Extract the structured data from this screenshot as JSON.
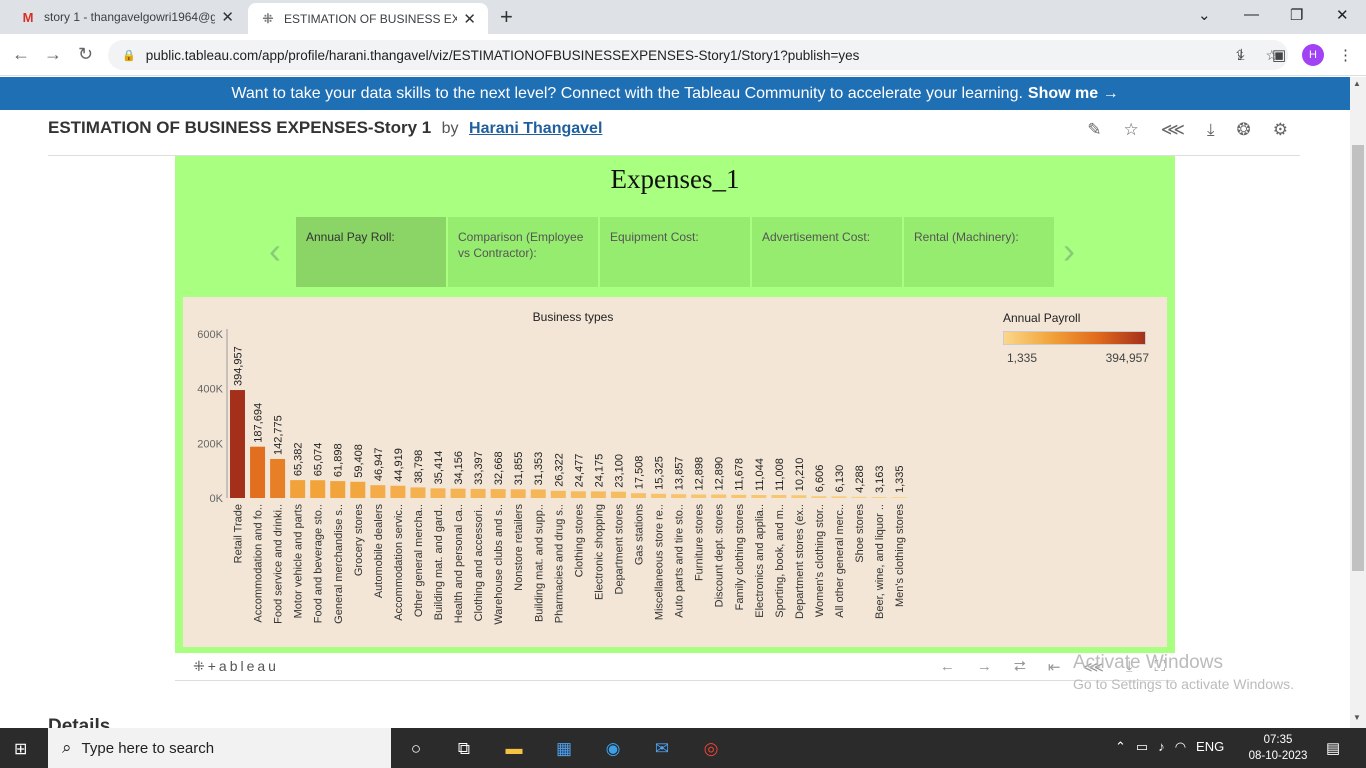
{
  "browser": {
    "tabs": [
      {
        "title": "story 1 - thangavelgowri1964@g",
        "icon": "gmail-icon"
      },
      {
        "title": "ESTIMATION OF BUSINESS EXPE",
        "icon": "tableau-icon"
      }
    ],
    "url": "public.tableau.com/app/profile/harani.thangavel/viz/ESTIMATIONOFBUSINESSEXPENSES-Story1/Story1?publish=yes",
    "profile_initial": "H"
  },
  "banner": {
    "text": "Want to take your data skills to the next level? Connect with the Tableau Community to accelerate your learning.",
    "link": "Show me →"
  },
  "viz": {
    "title": "ESTIMATION OF BUSINESS EXPENSES-Story 1",
    "by": "by",
    "author": "Harani Thangavel"
  },
  "story": {
    "title": "Expenses_1",
    "points": [
      "Annual Pay Roll:",
      "Comparison (Employee vs Contractor):",
      "Equipment Cost:",
      "Advertisement Cost:",
      "Rental (Machinery):"
    ]
  },
  "legend": {
    "title": "Annual Payroll",
    "min": "1,335",
    "max": "394,957",
    "colors": [
      "#fbd78a",
      "#f2a33a",
      "#e06a1c",
      "#a4301c"
    ]
  },
  "chart_data": {
    "type": "bar",
    "title": "Business types",
    "ylabel": "",
    "ylim": [
      0,
      600000
    ],
    "yticks": [
      "600K",
      "400K",
      "200K",
      "0K"
    ],
    "ytick_values": [
      600000,
      400000,
      200000,
      0
    ],
    "categories": [
      "Retail Trade",
      "Accommodation and fo..",
      "Food service and drinki..",
      "Motor vehicle and parts",
      "Food and beverage sto..",
      "General merchandise s..",
      "Grocery stores",
      "Automobile dealers",
      "Accommodation servic..",
      "Other general mercha..",
      "Building mat. and gard..",
      "Health and personal ca..",
      "Clothing and accessori..",
      "Warehouse clubs and s..",
      "Nonstore retailers",
      "Building mat. and supp..",
      "Pharmacies and drug s..",
      "Clothing stores",
      "Electronic shopping",
      "Department stores",
      "Gas stations",
      "Miscellaneous store re..",
      "Auto parts and tire sto..",
      "Furniture stores",
      "Discount dept. stores",
      "Family clothing stores",
      "Electronics and applia..",
      "Sporting, book, and m..",
      "Department stores (ex..",
      "Women's clothing stor..",
      "All other general merc..",
      "Shoe stores",
      "Beer, wine, and liquor ..",
      "Men's clothing stores"
    ],
    "values": [
      394957,
      187694,
      142775,
      65382,
      65074,
      61898,
      59408,
      46947,
      44919,
      38798,
      35414,
      34156,
      33397,
      32668,
      31855,
      31353,
      26322,
      24477,
      24175,
      23100,
      17508,
      15325,
      13857,
      12898,
      12890,
      11678,
      11044,
      11008,
      10210,
      6606,
      6130,
      4288,
      3163,
      1335
    ],
    "labels": [
      "394,957",
      "187,694",
      "142,775",
      "65,382",
      "65,074",
      "61,898",
      "59,408",
      "46,947",
      "44,919",
      "38,798",
      "35,414",
      "34,156",
      "33,397",
      "32,668",
      "31,855",
      "31,353",
      "26,322",
      "24,477",
      "24,175",
      "23,100",
      "17,508",
      "15,325",
      "13,857",
      "12,898",
      "12,890",
      "11,678",
      "11,044",
      "11,008",
      "10,210",
      "6,606",
      "6,130",
      "4,288",
      "3,163",
      "1,335"
    ],
    "color_scale": [
      "#fbd78a",
      "#f2a33a",
      "#e06a1c",
      "#a4301c"
    ]
  },
  "footer": {
    "logo": "⁜+ableau"
  },
  "details": "Details",
  "watermark": {
    "line1": "Activate Windows",
    "line2": "Go to Settings to activate Windows."
  },
  "taskbar": {
    "search_placeholder": "Type here to search",
    "lang": "ENG",
    "time": "07:35",
    "date": "08-10-2023"
  }
}
